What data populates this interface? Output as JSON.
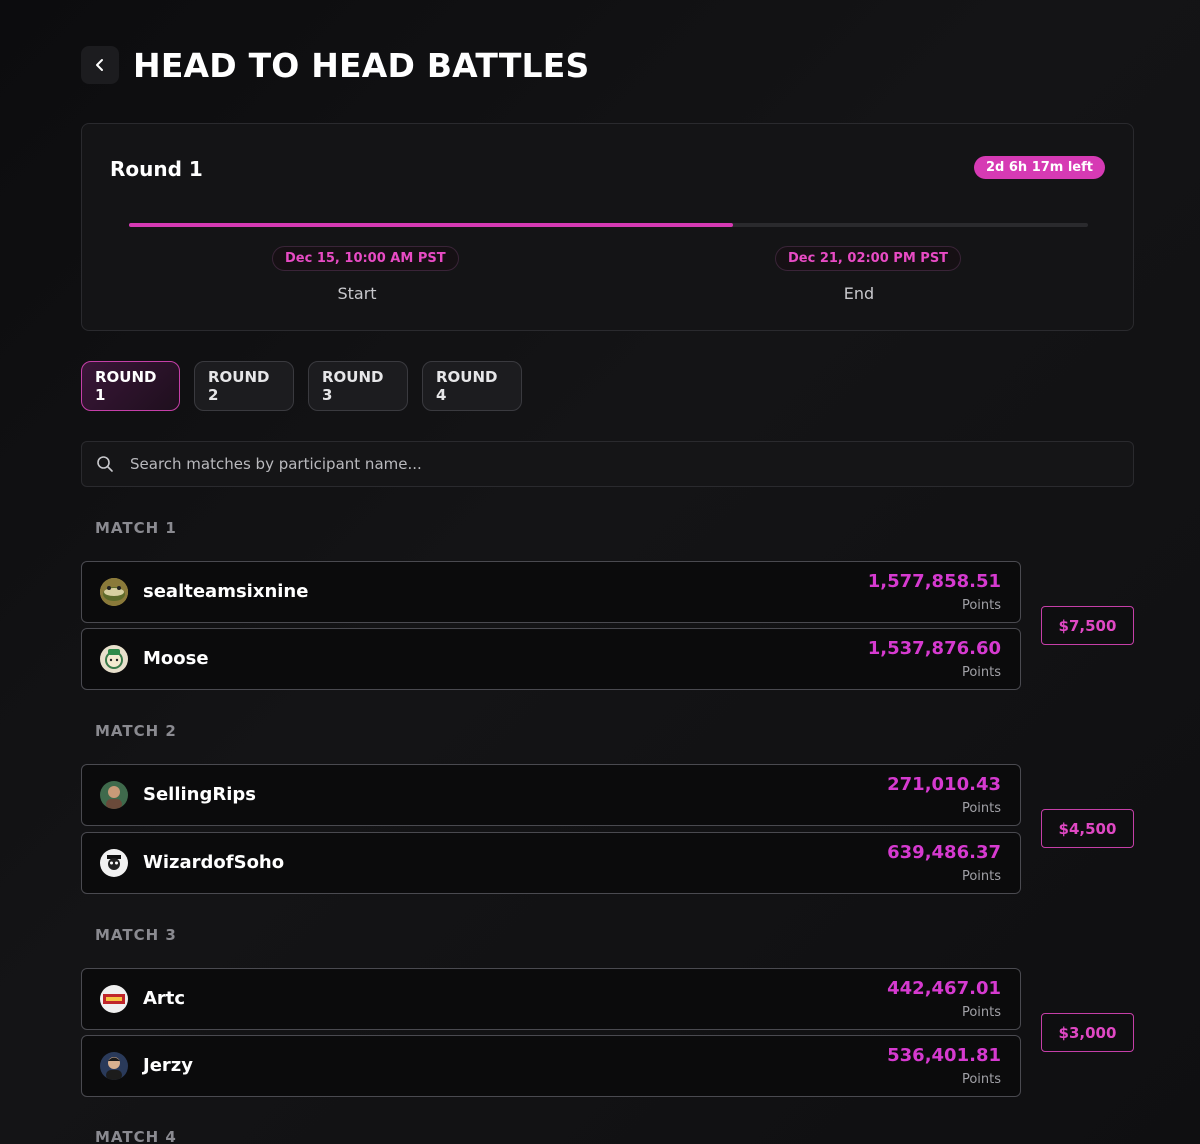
{
  "header": {
    "title": "HEAD TO HEAD BATTLES"
  },
  "round_card": {
    "title": "Round 1",
    "time_left": "2d 6h 17m left",
    "progress": 0.63,
    "start_date": "Dec 15, 10:00 AM PST",
    "start_label": "Start",
    "end_date": "Dec 21, 02:00 PM PST",
    "end_label": "End"
  },
  "tabs": [
    "ROUND 1",
    "ROUND 2",
    "ROUND 3",
    "ROUND 4"
  ],
  "active_tab": 0,
  "search": {
    "placeholder": "Search matches by participant name...",
    "value": ""
  },
  "points_caption": "Points",
  "matches": [
    {
      "label": "MATCH 1",
      "prize": "$7,500",
      "players": [
        {
          "name": "sealteamsixnine",
          "points": "1,577,858.51",
          "avatar": "frog-avatar"
        },
        {
          "name": "Moose",
          "points": "1,537,876.60",
          "avatar": "cartoon-avatar"
        }
      ]
    },
    {
      "label": "MATCH 2",
      "prize": "$4,500",
      "players": [
        {
          "name": "SellingRips",
          "points": "271,010.43",
          "avatar": "photo-avatar"
        },
        {
          "name": "WizardofSoho",
          "points": "639,486.37",
          "avatar": "skull-avatar"
        }
      ]
    },
    {
      "label": "MATCH 3",
      "prize": "$3,000",
      "players": [
        {
          "name": "Artc",
          "points": "442,467.01",
          "avatar": "red-logo-avatar"
        },
        {
          "name": "Jerzy",
          "points": "536,401.81",
          "avatar": "photo-avatar"
        }
      ]
    },
    {
      "label": "MATCH 4"
    }
  ],
  "colors": {
    "accent": "#d63ab4",
    "background": "#0e0e10",
    "border": "#4a4a50"
  }
}
